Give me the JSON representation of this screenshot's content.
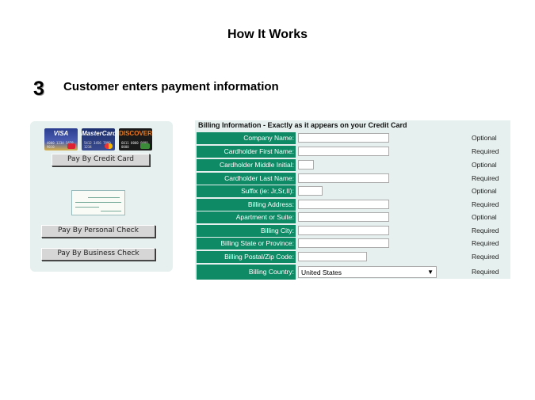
{
  "header": {
    "title": "How It Works"
  },
  "step": {
    "number": "3",
    "text": "Customer enters payment information"
  },
  "payment_panel": {
    "cards": [
      {
        "name": "VISA",
        "icon": "visa-card-icon"
      },
      {
        "name": "MasterCard",
        "icon": "mastercard-card-icon"
      },
      {
        "name": "DISCOVER",
        "icon": "discover-card-icon"
      }
    ],
    "credit_card_button": "Pay By Credit Card",
    "check_icon": "check-image-icon",
    "personal_check_button": "Pay By Personal Check",
    "business_check_button": "Pay By Business Check"
  },
  "billing_form": {
    "title": "Billing Information - Exactly as it appears on your Credit Card",
    "fields": [
      {
        "label": "Company Name:",
        "status": "Optional"
      },
      {
        "label": "Cardholder First Name:",
        "status": "Required"
      },
      {
        "label": "Cardholder Middle Initial:",
        "status": "Optional"
      },
      {
        "label": "Cardholder Last Name:",
        "status": "Required"
      },
      {
        "label": "Suffix (ie: Jr,Sr,II):",
        "status": "Optional"
      },
      {
        "label": "Billing Address:",
        "status": "Required"
      },
      {
        "label": "Apartment or Suite:",
        "status": "Optional"
      },
      {
        "label": "Billing City:",
        "status": "Required"
      },
      {
        "label": "Billing State or Province:",
        "status": "Required"
      },
      {
        "label": "Billing Postal/Zip Code:",
        "status": "Required"
      },
      {
        "label": "Billing Country:",
        "status": "Required",
        "selected": "United States"
      }
    ]
  },
  "colors": {
    "label_bg": "#0e8a65",
    "panel_bg": "#e6f0ee"
  }
}
